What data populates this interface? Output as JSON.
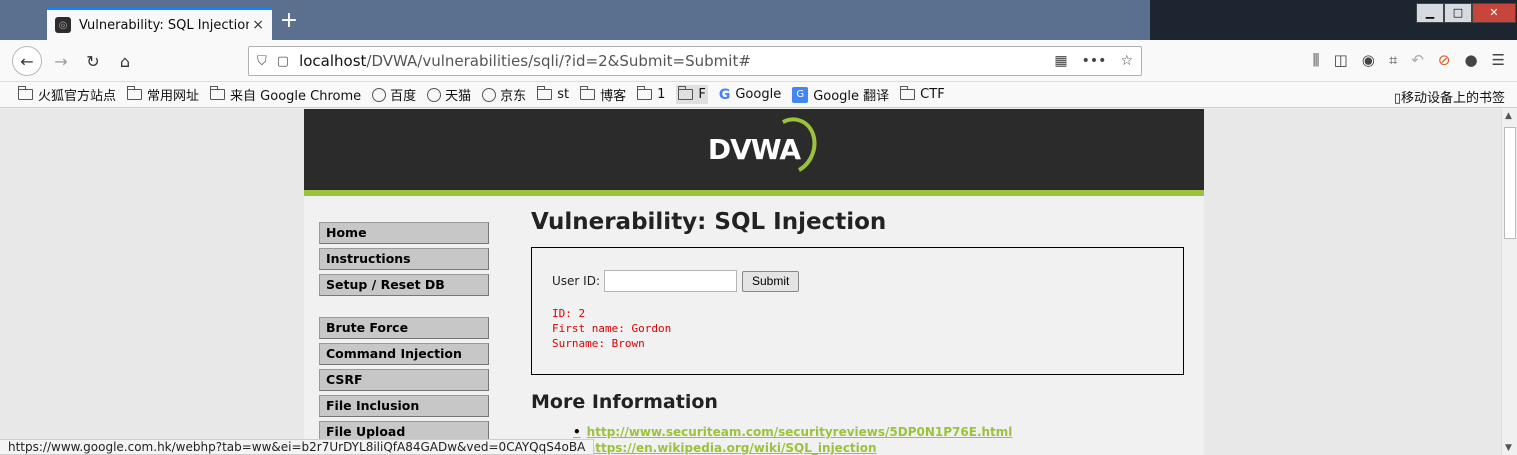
{
  "tab": {
    "title": "Vulnerability: SQL Injection ::",
    "close": "×",
    "new_tab": "+"
  },
  "window": {
    "minimize": "▁",
    "maximize": "□",
    "close": "✕"
  },
  "nav": {
    "back": "←",
    "forward": "→",
    "reload": "↻",
    "home": "⌂",
    "url_host": "localhost",
    "url_path": "/DVWA/vulnerabilities/sqli/?id=2&Submit=Submit#",
    "qr": "▦",
    "more": "•••",
    "star": "☆"
  },
  "toolbar_icons": [
    "library-icon",
    "sidebar-icon",
    "account-icon",
    "crop-icon",
    "undo-icon",
    "blocker-icon",
    "extension-icon",
    "menu-icon"
  ],
  "bookmarks": {
    "items": [
      {
        "label": "火狐官方站点",
        "icon": "ic"
      },
      {
        "label": "常用网址",
        "icon": "folder"
      },
      {
        "label": "来自 Google Chrome",
        "icon": "folder"
      },
      {
        "label": "百度",
        "icon": "globe"
      },
      {
        "label": "天猫",
        "icon": "globe"
      },
      {
        "label": "京东",
        "icon": "globe"
      },
      {
        "label": "st",
        "icon": "folder"
      },
      {
        "label": "博客",
        "icon": "folder"
      },
      {
        "label": "1",
        "icon": "folder"
      },
      {
        "label": "F",
        "icon": "folder"
      },
      {
        "label": "Google",
        "icon": "g"
      },
      {
        "label": "Google 翻译",
        "icon": "gt"
      },
      {
        "label": "CTF",
        "icon": "folder"
      }
    ],
    "mobile": "移动设备上的书签"
  },
  "dvwa": {
    "logo": "DVWA",
    "menu": {
      "group1": [
        "Home",
        "Instructions",
        "Setup / Reset DB"
      ],
      "group2": [
        "Brute Force",
        "Command Injection",
        "CSRF",
        "File Inclusion",
        "File Upload"
      ]
    },
    "title": "Vulnerability: SQL Injection",
    "form": {
      "label": "User ID:",
      "value": "",
      "submit": "Submit"
    },
    "result": [
      "ID: 2",
      "First name: Gordon",
      "Surname: Brown"
    ],
    "more_info": "More Information",
    "links": [
      "http://www.securiteam.com/securityreviews/5DP0N1P76E.html",
      "https://en.wikipedia.org/wiki/SQL_injection"
    ]
  },
  "status_url": "https://www.google.com.hk/webhp?tab=ww&ei=b2r7UrDYL8iliQfA84GADw&ved=0CAYQqS4oBA"
}
